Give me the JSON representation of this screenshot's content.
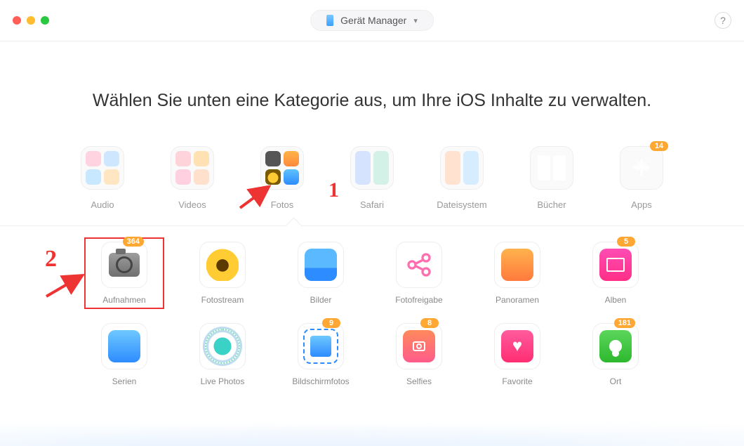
{
  "header": {
    "device_label": "Gerät Manager",
    "help": "?"
  },
  "headline": "Wählen Sie unten eine Kategorie aus, um Ihre iOS Inhalte zu verwalten.",
  "categories": [
    {
      "label": "Audio"
    },
    {
      "label": "Videos"
    },
    {
      "label": "Fotos"
    },
    {
      "label": "Safari"
    },
    {
      "label": "Dateisystem"
    },
    {
      "label": "Bücher"
    },
    {
      "label": "Apps",
      "badge": "14"
    }
  ],
  "sub": [
    {
      "label": "Aufnahmen",
      "badge": "364"
    },
    {
      "label": "Fotostream"
    },
    {
      "label": "Bilder"
    },
    {
      "label": "Fotofreigabe"
    },
    {
      "label": "Panoramen"
    },
    {
      "label": "Alben",
      "badge": "5"
    },
    {
      "label": "Serien"
    },
    {
      "label": "Live Photos"
    },
    {
      "label": "Bildschirmfotos",
      "badge": "9"
    },
    {
      "label": "Selfies",
      "badge": "8"
    },
    {
      "label": "Favorite"
    },
    {
      "label": "Ort",
      "badge": "181"
    }
  ],
  "annotations": {
    "one": "1",
    "two": "2"
  }
}
